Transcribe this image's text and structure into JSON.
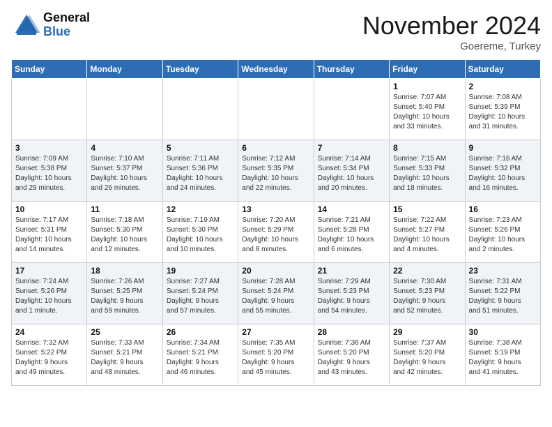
{
  "header": {
    "logo_general": "General",
    "logo_blue": "Blue",
    "month": "November 2024",
    "location": "Goereme, Turkey"
  },
  "weekdays": [
    "Sunday",
    "Monday",
    "Tuesday",
    "Wednesday",
    "Thursday",
    "Friday",
    "Saturday"
  ],
  "weeks": [
    [
      {
        "day": "",
        "info": ""
      },
      {
        "day": "",
        "info": ""
      },
      {
        "day": "",
        "info": ""
      },
      {
        "day": "",
        "info": ""
      },
      {
        "day": "",
        "info": ""
      },
      {
        "day": "1",
        "info": "Sunrise: 7:07 AM\nSunset: 5:40 PM\nDaylight: 10 hours\nand 33 minutes."
      },
      {
        "day": "2",
        "info": "Sunrise: 7:08 AM\nSunset: 5:39 PM\nDaylight: 10 hours\nand 31 minutes."
      }
    ],
    [
      {
        "day": "3",
        "info": "Sunrise: 7:09 AM\nSunset: 5:38 PM\nDaylight: 10 hours\nand 29 minutes."
      },
      {
        "day": "4",
        "info": "Sunrise: 7:10 AM\nSunset: 5:37 PM\nDaylight: 10 hours\nand 26 minutes."
      },
      {
        "day": "5",
        "info": "Sunrise: 7:11 AM\nSunset: 5:36 PM\nDaylight: 10 hours\nand 24 minutes."
      },
      {
        "day": "6",
        "info": "Sunrise: 7:12 AM\nSunset: 5:35 PM\nDaylight: 10 hours\nand 22 minutes."
      },
      {
        "day": "7",
        "info": "Sunrise: 7:14 AM\nSunset: 5:34 PM\nDaylight: 10 hours\nand 20 minutes."
      },
      {
        "day": "8",
        "info": "Sunrise: 7:15 AM\nSunset: 5:33 PM\nDaylight: 10 hours\nand 18 minutes."
      },
      {
        "day": "9",
        "info": "Sunrise: 7:16 AM\nSunset: 5:32 PM\nDaylight: 10 hours\nand 16 minutes."
      }
    ],
    [
      {
        "day": "10",
        "info": "Sunrise: 7:17 AM\nSunset: 5:31 PM\nDaylight: 10 hours\nand 14 minutes."
      },
      {
        "day": "11",
        "info": "Sunrise: 7:18 AM\nSunset: 5:30 PM\nDaylight: 10 hours\nand 12 minutes."
      },
      {
        "day": "12",
        "info": "Sunrise: 7:19 AM\nSunset: 5:30 PM\nDaylight: 10 hours\nand 10 minutes."
      },
      {
        "day": "13",
        "info": "Sunrise: 7:20 AM\nSunset: 5:29 PM\nDaylight: 10 hours\nand 8 minutes."
      },
      {
        "day": "14",
        "info": "Sunrise: 7:21 AM\nSunset: 5:28 PM\nDaylight: 10 hours\nand 6 minutes."
      },
      {
        "day": "15",
        "info": "Sunrise: 7:22 AM\nSunset: 5:27 PM\nDaylight: 10 hours\nand 4 minutes."
      },
      {
        "day": "16",
        "info": "Sunrise: 7:23 AM\nSunset: 5:26 PM\nDaylight: 10 hours\nand 2 minutes."
      }
    ],
    [
      {
        "day": "17",
        "info": "Sunrise: 7:24 AM\nSunset: 5:26 PM\nDaylight: 10 hours\nand 1 minute."
      },
      {
        "day": "18",
        "info": "Sunrise: 7:26 AM\nSunset: 5:25 PM\nDaylight: 9 hours\nand 59 minutes."
      },
      {
        "day": "19",
        "info": "Sunrise: 7:27 AM\nSunset: 5:24 PM\nDaylight: 9 hours\nand 57 minutes."
      },
      {
        "day": "20",
        "info": "Sunrise: 7:28 AM\nSunset: 5:24 PM\nDaylight: 9 hours\nand 55 minutes."
      },
      {
        "day": "21",
        "info": "Sunrise: 7:29 AM\nSunset: 5:23 PM\nDaylight: 9 hours\nand 54 minutes."
      },
      {
        "day": "22",
        "info": "Sunrise: 7:30 AM\nSunset: 5:23 PM\nDaylight: 9 hours\nand 52 minutes."
      },
      {
        "day": "23",
        "info": "Sunrise: 7:31 AM\nSunset: 5:22 PM\nDaylight: 9 hours\nand 51 minutes."
      }
    ],
    [
      {
        "day": "24",
        "info": "Sunrise: 7:32 AM\nSunset: 5:22 PM\nDaylight: 9 hours\nand 49 minutes."
      },
      {
        "day": "25",
        "info": "Sunrise: 7:33 AM\nSunset: 5:21 PM\nDaylight: 9 hours\nand 48 minutes."
      },
      {
        "day": "26",
        "info": "Sunrise: 7:34 AM\nSunset: 5:21 PM\nDaylight: 9 hours\nand 46 minutes."
      },
      {
        "day": "27",
        "info": "Sunrise: 7:35 AM\nSunset: 5:20 PM\nDaylight: 9 hours\nand 45 minutes."
      },
      {
        "day": "28",
        "info": "Sunrise: 7:36 AM\nSunset: 5:20 PM\nDaylight: 9 hours\nand 43 minutes."
      },
      {
        "day": "29",
        "info": "Sunrise: 7:37 AM\nSunset: 5:20 PM\nDaylight: 9 hours\nand 42 minutes."
      },
      {
        "day": "30",
        "info": "Sunrise: 7:38 AM\nSunset: 5:19 PM\nDaylight: 9 hours\nand 41 minutes."
      }
    ]
  ]
}
